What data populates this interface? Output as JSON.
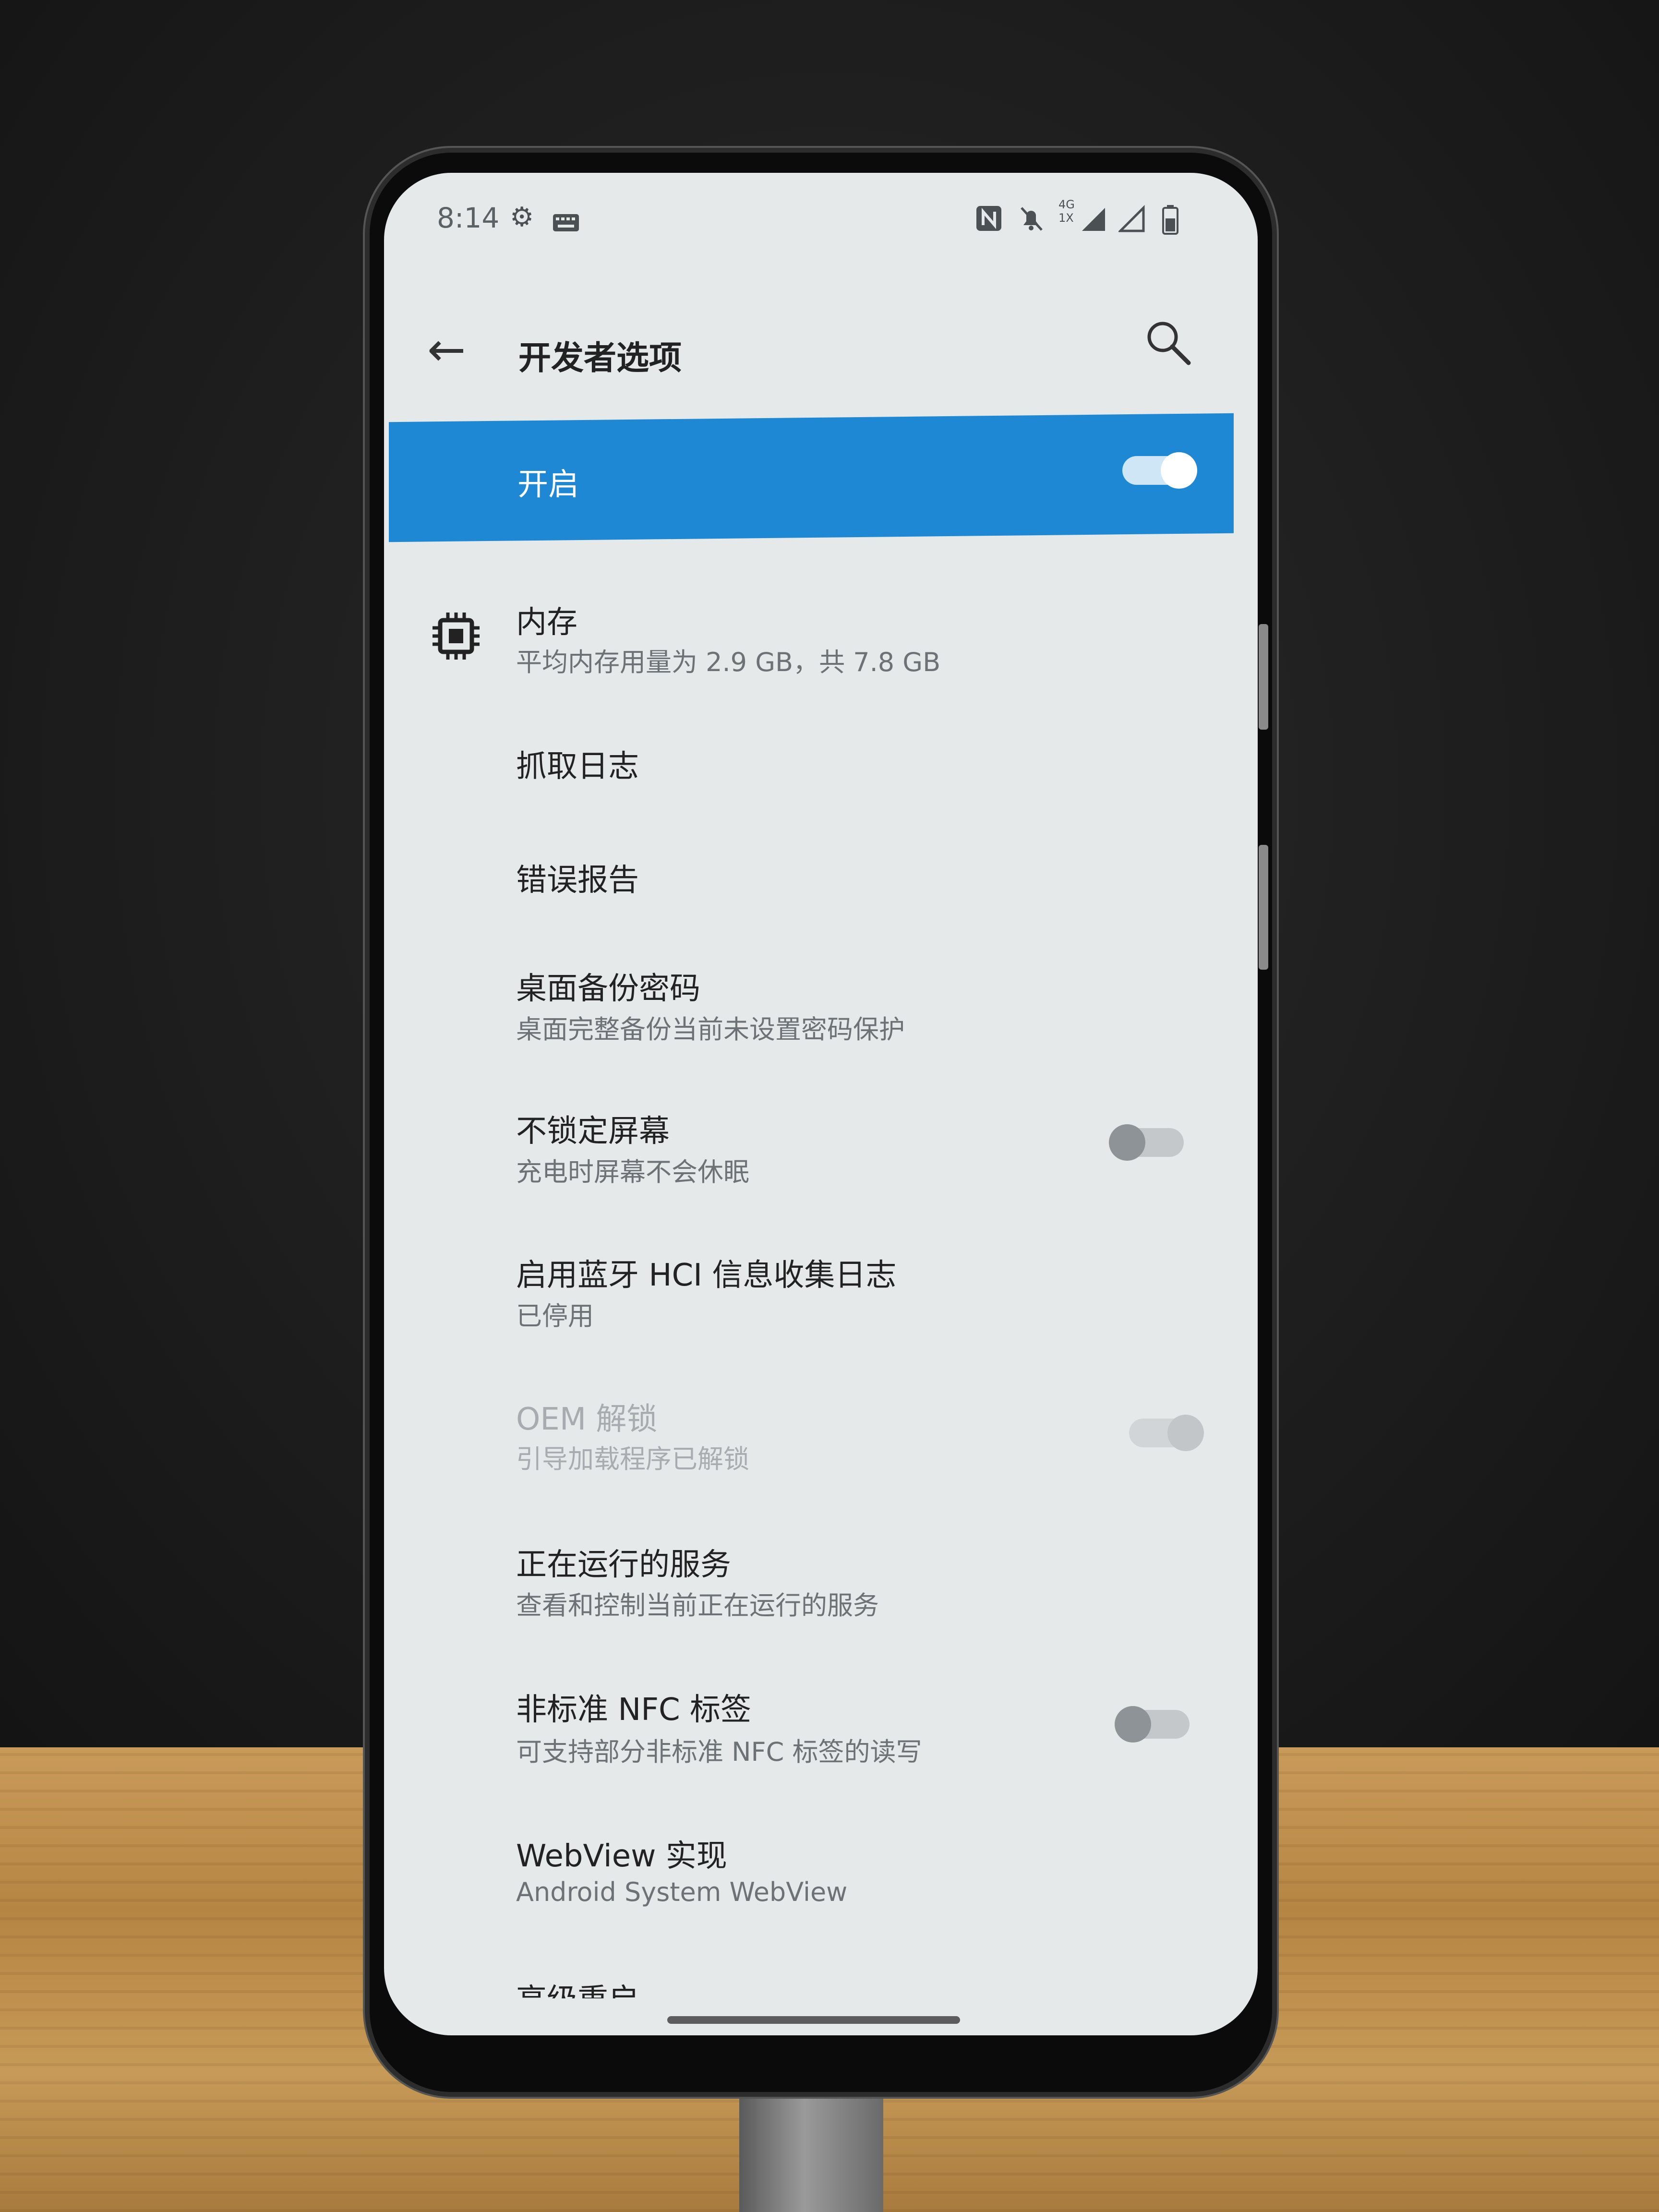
{
  "status_bar": {
    "time": "8:14",
    "left_icons": [
      "gear-icon",
      "keyboard-icon"
    ],
    "right_icons": [
      "nfc-icon",
      "mute-icon",
      "4g-signal-icon",
      "signal-icon",
      "battery-icon"
    ],
    "network_label_top": "4G",
    "network_label_bottom": "1X"
  },
  "header": {
    "title": "开发者选项",
    "back_icon": "back-arrow-icon",
    "search_icon": "search-icon"
  },
  "enable_toggle": {
    "label": "开启",
    "on": true,
    "accent_color": "#1e88d4"
  },
  "settings": [
    {
      "id": "memory",
      "title": "内存",
      "subtitle": "平均内存用量为 2.9 GB，共 7.8 GB",
      "icon": "memory-chip-icon"
    },
    {
      "id": "capture-log",
      "title": "抓取日志"
    },
    {
      "id": "bug-report",
      "title": "错误报告"
    },
    {
      "id": "desktop-backup",
      "title": "桌面备份密码",
      "subtitle": "桌面完整备份当前未设置密码保护"
    },
    {
      "id": "stay-awake",
      "title": "不锁定屏幕",
      "subtitle": "充电时屏幕不会休眠",
      "toggle": false
    },
    {
      "id": "bt-hci-log",
      "title": "启用蓝牙 HCI 信息收集日志",
      "subtitle": "已停用"
    },
    {
      "id": "oem-unlock",
      "title": "OEM 解锁",
      "subtitle": "引导加载程序已解锁",
      "toggle": true,
      "disabled": true
    },
    {
      "id": "running-services",
      "title": "正在运行的服务",
      "subtitle": "查看和控制当前正在运行的服务"
    },
    {
      "id": "nonstandard-nfc",
      "title": "非标准 NFC 标签",
      "subtitle": "可支持部分非标准 NFC 标签的读写",
      "toggle": false
    },
    {
      "id": "webview",
      "title": "WebView 实现",
      "subtitle": "Android System WebView"
    },
    {
      "id": "advanced-reboot",
      "title": "高级重启"
    }
  ]
}
